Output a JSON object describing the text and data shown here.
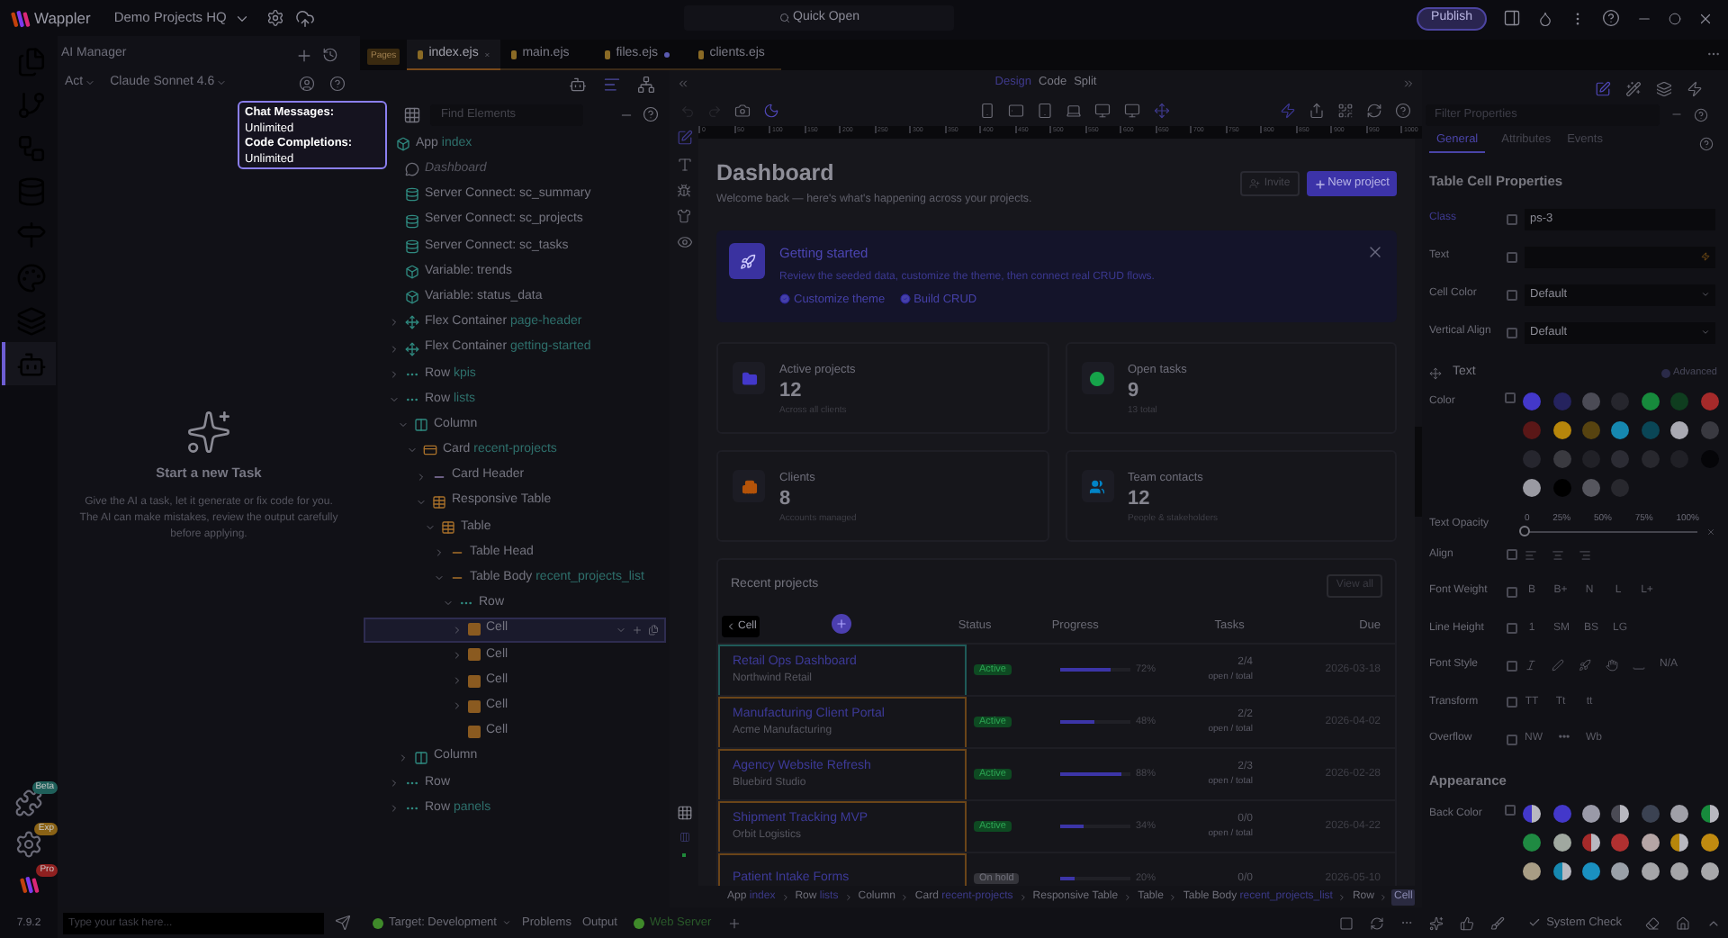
{
  "title_bar": {
    "app_name": "Wappler",
    "project": "Demo Projects HQ",
    "quick_open": "Quick Open",
    "publish": "Publish"
  },
  "activity_bar": {
    "items": [
      {
        "kind": "pages",
        "selected": false
      },
      {
        "kind": "git",
        "selected": false
      },
      {
        "kind": "workflow",
        "selected": false
      },
      {
        "kind": "database",
        "selected": false
      },
      {
        "kind": "routes",
        "selected": false
      },
      {
        "kind": "design",
        "selected": false
      },
      {
        "kind": "layers",
        "selected": false
      },
      {
        "kind": "ai",
        "selected": true
      }
    ],
    "bottom": [
      {
        "kind": "extensions",
        "badge": "Beta"
      },
      {
        "kind": "settings",
        "badge": "Exp"
      },
      {
        "kind": "logo",
        "badge": "Pro"
      }
    ],
    "version": "7.9.2"
  },
  "ai_manager": {
    "title": "AI Manager",
    "mode": "Act",
    "model": "Claude Sonnet 4.6",
    "tooltip": [
      {
        "label": "Chat Messages:",
        "value": "Unlimited"
      },
      {
        "label": "Code Completions:",
        "value": "Unlimited"
      }
    ],
    "empty_title": "Start a new Task",
    "empty_text": "Give the AI a task, let it generate or fix code for you. The AI can make mistakes, review the output carefully before applying.",
    "input_placeholder": "Type your task here..."
  },
  "editor_tabs": {
    "badge": "Pages",
    "tabs": [
      {
        "label": "index.ejs",
        "selected": true,
        "modified": false
      },
      {
        "label": "main.ejs",
        "selected": false,
        "modified": false
      },
      {
        "label": "files.ejs",
        "selected": false,
        "modified": true
      },
      {
        "label": "clients.ejs",
        "selected": false,
        "modified": false
      }
    ]
  },
  "tree": {
    "search_placeholder": "Find Elements",
    "items": [
      {
        "kind": "app",
        "label": "App",
        "name": "index",
        "selected": false,
        "children": [
          {
            "kind": "comment",
            "label": "Dashboard",
            "selected": false
          },
          {
            "kind": "server",
            "label": "Server Connect: sc_summary",
            "selected": false
          },
          {
            "kind": "server",
            "label": "Server Connect: sc_projects",
            "selected": false
          },
          {
            "kind": "server",
            "label": "Server Connect: sc_tasks",
            "selected": false
          },
          {
            "kind": "variable",
            "label": "Variable: trends",
            "selected": false
          },
          {
            "kind": "variable",
            "label": "Variable: status_data",
            "selected": false
          },
          {
            "kind": "flex",
            "label": "Flex Container",
            "name": "page-header",
            "expanded": false,
            "selected": false
          },
          {
            "kind": "flex",
            "label": "Flex Container",
            "name": "getting-started",
            "expanded": false,
            "selected": false
          },
          {
            "kind": "row",
            "label": "Row",
            "name": "kpis",
            "expanded": false,
            "selected": false
          },
          {
            "kind": "row",
            "label": "Row",
            "name": "lists",
            "expanded": true,
            "selected": false,
            "children": [
              {
                "kind": "column",
                "label": "Column",
                "expanded": true,
                "selected": false,
                "children": [
                  {
                    "kind": "card",
                    "label": "Card",
                    "name": "recent-projects",
                    "expanded": true,
                    "selected": false,
                    "children": [
                      {
                        "kind": "header",
                        "label": "Card Header",
                        "expanded": false,
                        "selected": false
                      },
                      {
                        "kind": "table",
                        "label": "Responsive Table",
                        "expanded": true,
                        "selected": false,
                        "children": [
                          {
                            "kind": "table",
                            "label": "Table",
                            "expanded": true,
                            "selected": false,
                            "children": [
                              {
                                "kind": "section",
                                "label": "Table Head",
                                "expanded": false,
                                "selected": false
                              },
                              {
                                "kind": "section",
                                "label": "Table Body",
                                "name": "recent_projects_list",
                                "expanded": true,
                                "selected": false,
                                "children": [
                                  {
                                    "kind": "row",
                                    "label": "Row",
                                    "expanded": true,
                                    "selected": false,
                                    "children": [
                                      {
                                        "kind": "cell",
                                        "label": "Cell",
                                        "expanded": false,
                                        "selected": true
                                      },
                                      {
                                        "kind": "cell",
                                        "label": "Cell",
                                        "expanded": false,
                                        "selected": false
                                      },
                                      {
                                        "kind": "cell",
                                        "label": "Cell",
                                        "expanded": false,
                                        "selected": false
                                      },
                                      {
                                        "kind": "cell",
                                        "label": "Cell",
                                        "expanded": false,
                                        "selected": false
                                      },
                                      {
                                        "kind": "cell",
                                        "label": "Cell",
                                        "selected": false
                                      }
                                    ]
                                  }
                                ]
                              }
                            ]
                          }
                        ]
                      }
                    ]
                  }
                ]
              },
              {
                "kind": "column",
                "label": "Column",
                "expanded": false,
                "selected": false
              }
            ]
          },
          {
            "kind": "row",
            "label": "Row",
            "expanded": false,
            "selected": false
          },
          {
            "kind": "row",
            "label": "Row",
            "name": "panels",
            "expanded": false,
            "selected": false
          }
        ]
      }
    ]
  },
  "design": {
    "modes": [
      {
        "label": "Design",
        "selected": true
      },
      {
        "label": "Code",
        "selected": false
      },
      {
        "label": "Split",
        "selected": false
      }
    ],
    "ruler": [
      "0",
      "50",
      "100",
      "150",
      "200",
      "250",
      "300",
      "350",
      "400",
      "450",
      "500",
      "550",
      "600",
      "650",
      "700",
      "750",
      "800",
      "850",
      "900",
      "950",
      "1000"
    ],
    "page": {
      "title": "Dashboard",
      "subtitle": "Welcome back — here's what's happening across your projects.",
      "invite": "Invite",
      "new_project": "New project",
      "getting_started": {
        "title": "Getting started",
        "text": "Review the seeded data, customize the theme, then connect real CRUD flows.",
        "checks": [
          "Customize theme",
          "Build CRUD"
        ]
      },
      "kpis": [
        {
          "kind": "projects",
          "label": "Active projects",
          "value": "12",
          "caption": "Across all clients",
          "color": "#4338ca"
        },
        {
          "kind": "tasks",
          "label": "Open tasks",
          "value": "9",
          "caption": "13 total",
          "color": "#16a34a"
        },
        {
          "kind": "clients",
          "label": "Clients",
          "value": "8",
          "caption": "Accounts managed",
          "color": "#b45309"
        },
        {
          "kind": "contacts",
          "label": "Team contacts",
          "value": "12",
          "caption": "People & stakeholders",
          "color": "#0284c7"
        }
      ],
      "recent": {
        "title": "Recent projects",
        "view_all": "View all",
        "selection_tag": "Cell",
        "columns": [
          "Status",
          "Progress",
          "Tasks",
          "Due"
        ],
        "rows": [
          {
            "name": "Retail Ops Dashboard",
            "client": "Northwind Retail",
            "status": {
              "text": "Active",
              "kind": "active"
            },
            "level": 0.72,
            "percent": "72%",
            "tasks": "2/4",
            "tasks_caption": "open / total",
            "due": "2026-03-18",
            "selected": true
          },
          {
            "name": "Manufacturing Client Portal",
            "client": "Acme Manufacturing",
            "status": {
              "text": "Active",
              "kind": "active"
            },
            "level": 0.48,
            "percent": "48%",
            "tasks": "2/2",
            "tasks_caption": "open / total",
            "due": "2026-04-02",
            "selected": false
          },
          {
            "name": "Agency Website Refresh",
            "client": "Bluebird Studio",
            "status": {
              "text": "Active",
              "kind": "active"
            },
            "level": 0.88,
            "percent": "88%",
            "tasks": "2/3",
            "tasks_caption": "open / total",
            "due": "2026-02-28",
            "selected": false
          },
          {
            "name": "Shipment Tracking MVP",
            "client": "Orbit Logistics",
            "status": {
              "text": "Active",
              "kind": "active"
            },
            "level": 0.34,
            "percent": "34%",
            "tasks": "0/0",
            "tasks_caption": "open / total",
            "due": "2026-04-22",
            "selected": false
          },
          {
            "name": "Patient Intake Forms",
            "status": {
              "text": "On hold",
              "kind": "on_hold"
            },
            "level": 0.2,
            "percent": "20%",
            "tasks": "0/0",
            "due": "2026-05-10",
            "selected": false
          }
        ]
      }
    },
    "breadcrumb": [
      {
        "label": "App",
        "name": "index",
        "selected": false
      },
      {
        "label": "Row",
        "name": "lists",
        "selected": false
      },
      {
        "label": "Column",
        "selected": false
      },
      {
        "label": "Card",
        "name": "recent-projects",
        "selected": false
      },
      {
        "label": "Responsive Table",
        "selected": false
      },
      {
        "label": "Table",
        "selected": false
      },
      {
        "label": "Table Body",
        "name": "recent_projects_list",
        "selected": false
      },
      {
        "label": "Row",
        "selected": false
      },
      {
        "label": "Cell",
        "selected": true
      }
    ]
  },
  "properties": {
    "filter_placeholder": "Filter Properties",
    "tabs": [
      {
        "label": "General",
        "selected": true
      },
      {
        "label": "Attributes",
        "selected": false
      },
      {
        "label": "Events",
        "selected": false
      }
    ],
    "title": "Table Cell Properties",
    "fields": [
      {
        "label": "Class",
        "kind": "text",
        "value": "ps-3",
        "active": true
      },
      {
        "label": "Text",
        "kind": "dynamic",
        "active": false
      },
      {
        "label": "Cell Color",
        "kind": "select",
        "value": "Default",
        "active": false
      },
      {
        "label": "Vertical Align",
        "kind": "select",
        "value": "Default",
        "active": false
      }
    ],
    "text_section": {
      "title": "Text",
      "advanced": {
        "label": "Advanced",
        "on": false
      },
      "color_label": "Color",
      "colors": [
        {
          "color": "#4338ca"
        },
        {
          "color": "#25235e"
        },
        {
          "color": "#4b4b55"
        },
        {
          "color": "#26262d"
        },
        {
          "color": "#178a3c"
        },
        {
          "color": "#0f3d1f"
        },
        {
          "color": "#a52a2a"
        },
        {
          "color": "#5a1717"
        },
        {
          "color": "#b7860b"
        },
        {
          "color": "#574310"
        },
        {
          "color": "#1688b0"
        },
        {
          "color": "#0a4656"
        },
        {
          "color": "#a9a9b2"
        },
        {
          "color": "#393940"
        },
        {
          "color": "#26262e"
        },
        {
          "color": "#3a3a40"
        },
        {
          "color": "#212127"
        },
        {
          "color": "#2c2c34"
        },
        {
          "color": "#28282e"
        },
        {
          "color": "#202026"
        },
        {
          "color": "#050508"
        },
        {
          "color": "#9a9aa2"
        },
        {
          "color": "#000000"
        },
        {
          "color": "#56565e"
        },
        {
          "color": "#28282e"
        }
      ],
      "opacity": {
        "label": "Text Opacity",
        "ticks": [
          "0",
          "25%",
          "50%",
          "75%",
          "100%"
        ],
        "level": 0
      },
      "rows": [
        {
          "label": "Align",
          "kind": "align"
        },
        {
          "label": "Font Weight",
          "kind": "text",
          "options": [
            "B",
            "B+",
            "N",
            "L",
            "L+"
          ]
        },
        {
          "label": "Line Height",
          "kind": "text",
          "options": [
            "1",
            "SM",
            "BS",
            "LG"
          ]
        },
        {
          "label": "Font Style",
          "kind": "font_style",
          "options": [
            "N/A"
          ]
        },
        {
          "label": "Transform",
          "kind": "text",
          "options": [
            "TT",
            "Tt",
            "tt"
          ]
        },
        {
          "label": "Overflow",
          "kind": "text",
          "options": [
            "NW",
            "•••",
            "Wb"
          ]
        }
      ]
    },
    "appearance": {
      "title": "Appearance",
      "back_color_label": "Back Color",
      "colors": [
        {
          "color": "#4338ca",
          "split": true
        },
        {
          "color": "#4338ca",
          "split": false
        },
        {
          "color": "#9a9aa8",
          "split": false
        },
        {
          "color": "#4b4b55",
          "split": true
        },
        {
          "color": "#3b4252",
          "split": false
        },
        {
          "color": "#a0a0a8",
          "split": false
        },
        {
          "color": "#178a3c",
          "split": true
        },
        {
          "color": "#1f8a42",
          "split": false
        },
        {
          "color": "#a0a8a0",
          "split": false
        },
        {
          "color": "#a52a2a",
          "split": true
        },
        {
          "color": "#b03030",
          "split": false
        },
        {
          "color": "#b5a5a5",
          "split": false
        },
        {
          "color": "#b7860b",
          "split": true
        },
        {
          "color": "#c08a10",
          "split": false
        },
        {
          "color": "#a89d85",
          "split": false
        },
        {
          "color": "#1688b0",
          "split": true
        },
        {
          "color": "#1a90c0",
          "split": false
        },
        {
          "color": "#9aa0a8",
          "split": false
        },
        {
          "color": "#a5a5a8",
          "split": false
        },
        {
          "color": "#a5a5a8",
          "split": false
        },
        {
          "color": "#a8a8aa",
          "split": false
        }
      ]
    }
  },
  "status_bar": {
    "target": "Target: Development",
    "items": [
      "Problems",
      "Output"
    ],
    "server": "Web Server",
    "system_check": "System Check"
  }
}
